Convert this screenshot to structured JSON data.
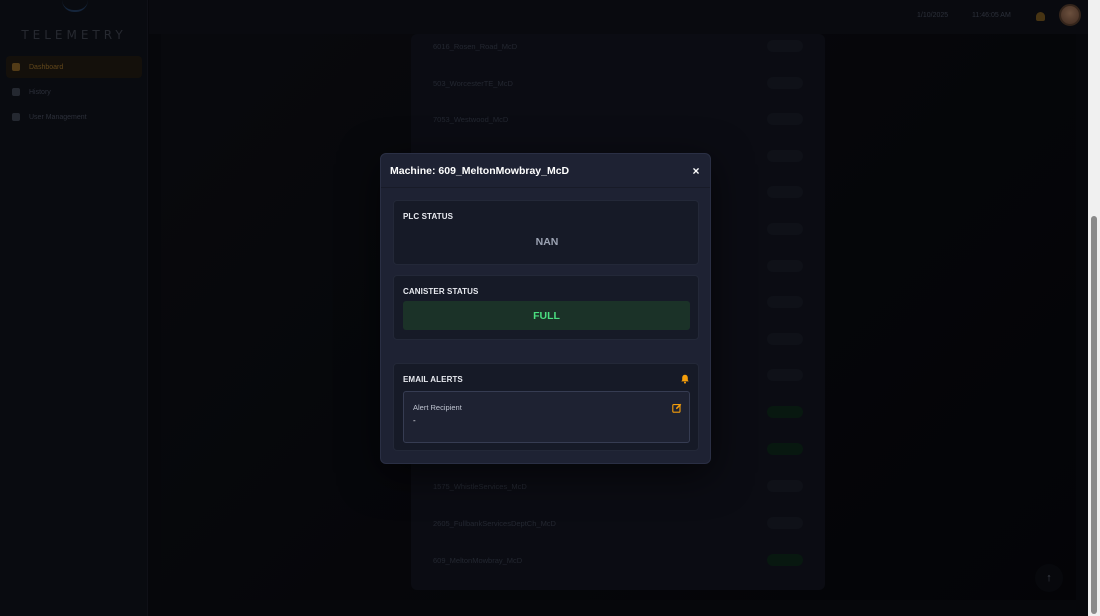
{
  "app": {
    "logo_text": "TELEMETRY"
  },
  "sidebar": {
    "items": [
      {
        "label": "Dashboard",
        "icon": "home-icon",
        "active": true
      },
      {
        "label": "History",
        "icon": "history-icon",
        "active": false
      },
      {
        "label": "User Management",
        "icon": "users-icon",
        "active": false
      }
    ]
  },
  "topbar": {
    "date": "1/10/2025",
    "time": "11:46:05 AM",
    "bell_icon": "bell-icon"
  },
  "machine_list": [
    {
      "name": "6016_Rosen_Road_McD",
      "status": "Idle"
    },
    {
      "name": "503_WorcesterTE_McD",
      "status": "Idle"
    },
    {
      "name": "7053_Westwood_McD",
      "status": "Idle"
    },
    {
      "name": "",
      "status": "Idle"
    },
    {
      "name": "",
      "status": "Idle"
    },
    {
      "name": "",
      "status": "Idle"
    },
    {
      "name": "",
      "status": "Idle"
    },
    {
      "name": "",
      "status": "Idle"
    },
    {
      "name": "",
      "status": "Idle"
    },
    {
      "name": "",
      "status": "Idle"
    },
    {
      "name": "",
      "status": "Filling"
    },
    {
      "name": "",
      "status": "Filling"
    },
    {
      "name": "1575_WhistleServices_McD",
      "status": "Idle"
    },
    {
      "name": "2605_FullbankServicesDeptCh_McD",
      "status": "Idle"
    },
    {
      "name": "609_MeltonMowbray_McD",
      "status": "Filling"
    }
  ],
  "modal": {
    "title": "Machine: 609_MeltonMowbray_McD",
    "close_label": "×",
    "plc": {
      "label": "PLC STATUS",
      "value": "NAN"
    },
    "canister": {
      "label": "CANISTER STATUS",
      "value": "FULL",
      "color": "#4ade80"
    },
    "email_alerts": {
      "label": "EMAIL ALERTS",
      "recipient_label": "Alert Recipient",
      "recipient_value": "-"
    }
  },
  "colors": {
    "accent": "#f59e0b",
    "success": "#4ade80",
    "modal_bg": "#1e2233"
  }
}
